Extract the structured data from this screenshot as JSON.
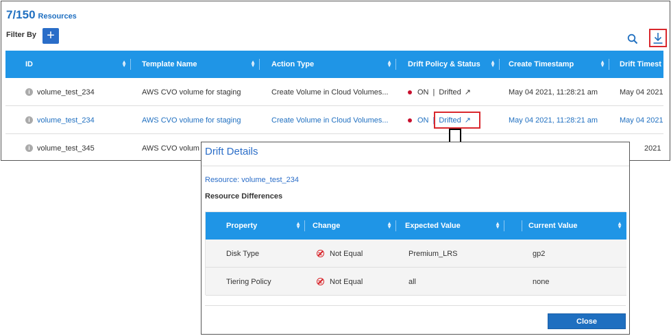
{
  "header": {
    "count": "7/150",
    "count_label": "Resources",
    "filter_label": "Filter By",
    "filter_add": "+"
  },
  "table": {
    "columns": [
      "ID",
      "Template Name",
      "Action Type",
      "Drift Policy & Status",
      "Create Timestamp",
      "Drift Timest"
    ],
    "rows": [
      {
        "id": "volume_test_234",
        "template": "AWS CVO volume for staging",
        "action": "Create Volume in Cloud Volumes...",
        "policy": "ON",
        "status": "Drifted",
        "created": "May 04 2021, 11:28:21 am",
        "drift_ts": "May 04 2021"
      },
      {
        "id": "volume_test_234",
        "template": "AWS CVO volume for staging",
        "action": "Create Volume in Cloud Volumes...",
        "policy": "ON",
        "status": "Drifted",
        "created": "May 04 2021, 11:28:21 am",
        "drift_ts": "May 04 2021"
      },
      {
        "id": "volume_test_345",
        "template": "AWS CVO volum",
        "action": "",
        "policy": "",
        "status": "",
        "created": "",
        "drift_ts": "2021"
      }
    ]
  },
  "modal": {
    "title": "Drift Details",
    "resource_label": "Resource:",
    "resource_value": "volume_test_234",
    "section": "Resource Differences",
    "columns": [
      "Property",
      "Change",
      "Expected Value",
      "Current Value"
    ],
    "rows": [
      {
        "property": "Disk Type",
        "change": "Not Equal",
        "expected": "Premium_LRS",
        "current": "gp2"
      },
      {
        "property": "Tiering Policy",
        "change": "Not Equal",
        "expected": "all",
        "current": "none"
      }
    ],
    "close_label": "Close"
  },
  "colors": {
    "accent": "#1f95e6",
    "brand": "#2a6dc8",
    "alert": "#d9262c"
  }
}
